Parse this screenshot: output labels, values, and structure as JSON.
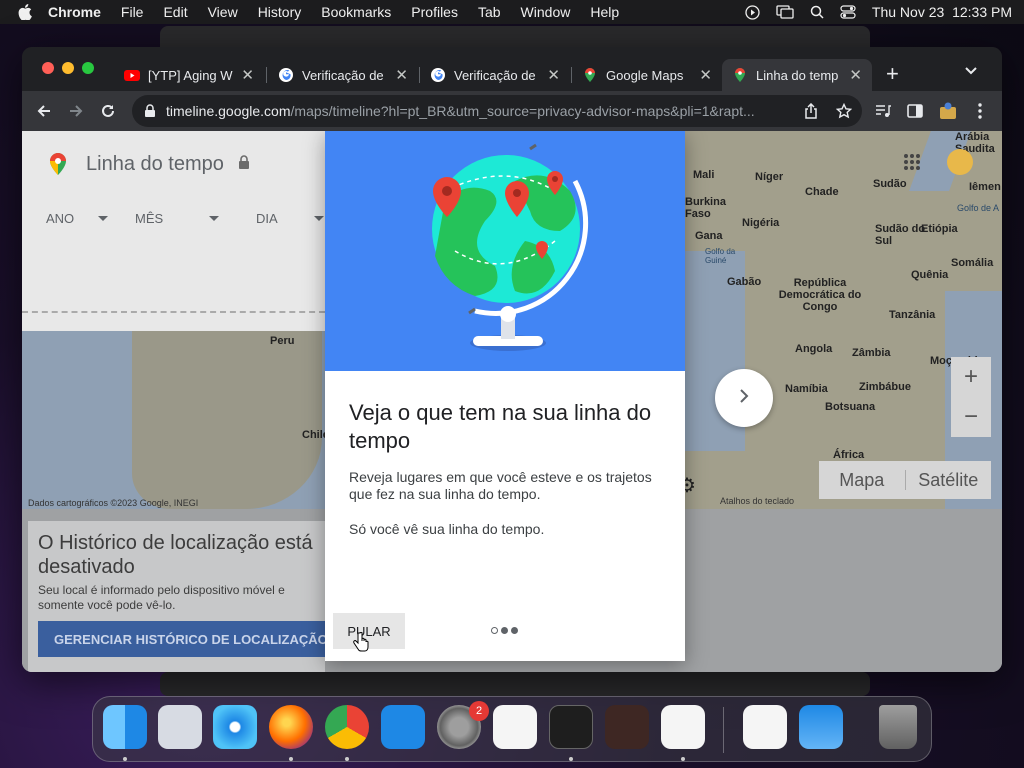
{
  "menubar": {
    "app": "Chrome",
    "items": [
      "File",
      "Edit",
      "View",
      "History",
      "Bookmarks",
      "Profiles",
      "Tab",
      "Window",
      "Help"
    ],
    "datetime": "Thu Nov 23  12:33 PM"
  },
  "tabs": [
    {
      "title": "[YTP] Aging W",
      "favicon": "youtube-icon"
    },
    {
      "title": "Verificação de",
      "favicon": "google-icon"
    },
    {
      "title": "Verificação de",
      "favicon": "google-icon"
    },
    {
      "title": "Google Maps",
      "favicon": "maps-icon"
    },
    {
      "title": "Linha do temp",
      "favicon": "maps-icon",
      "active": true
    }
  ],
  "omnibox": {
    "host": "timeline.google.com",
    "path": "/maps/timeline?hl=pt_BR&utm_source=privacy-advisor-maps&pli=1&rapt..."
  },
  "sidepanel": {
    "title": "Linha do tempo",
    "filters": [
      "ANO",
      "MÊS",
      "DIA"
    ]
  },
  "map": {
    "labels": {
      "peru": "Peru",
      "chile": "Chile",
      "arabia": "Arábia Saudita",
      "mali": "Mali",
      "niger": "Níger",
      "chade": "Chade",
      "sudao": "Sudão",
      "iemen": "Iêmen",
      "burkina": "Burkina Faso",
      "nigeria": "Nigéria",
      "gana": "Gana",
      "etiopia": "Etiópia",
      "sudao_sul": "Sudão do Sul",
      "somalia": "Somália",
      "gabao": "Gabão",
      "rdc": "República Democrática do Congo",
      "quenia": "Quênia",
      "tanzania": "Tanzânia",
      "angola": "Angola",
      "zambia": "Zâmbia",
      "mocambique": "Moçambi",
      "namibia": "Namíbia",
      "zimbabue": "Zimbábue",
      "botsuana": "Botsuana",
      "africa": "África",
      "golfo": "Golfo de A",
      "guine": "Golfo da Guiné"
    },
    "attribution": "Dados cartográficos ©2023 Google, INEGI",
    "shortcuts": "Atalhos do teclado",
    "type_map": "Mapa",
    "type_satellite": "Satélite",
    "zoom_in": "+",
    "zoom_out": "−"
  },
  "history": {
    "title": "O Histórico de localização está desativado",
    "body": "Seu local é informado pelo dispositivo móvel e somente você pode vê-lo.",
    "button": "GERENCIAR HISTÓRICO DE LOCALIZAÇÃO"
  },
  "modal": {
    "title": "Veja o que tem na sua linha do tempo",
    "text1": "Reveja lugares em que você esteve e os trajetos que fez na sua linha do tempo.",
    "text2": "Só você vê sua linha do tempo.",
    "skip": "PULAR",
    "pages": 3,
    "current_page": 1
  },
  "dock": {
    "apps": [
      "finder-icon",
      "launchpad-icon",
      "safari-icon",
      "firefox-icon",
      "chrome-icon",
      "app-store-icon",
      "system-settings-icon",
      "textedit-icon",
      "terminal-icon",
      "garageband-icon",
      "vscode-icon",
      "visual-studio-icon",
      "weather-icon",
      "trash-icon"
    ],
    "badge": "2"
  }
}
